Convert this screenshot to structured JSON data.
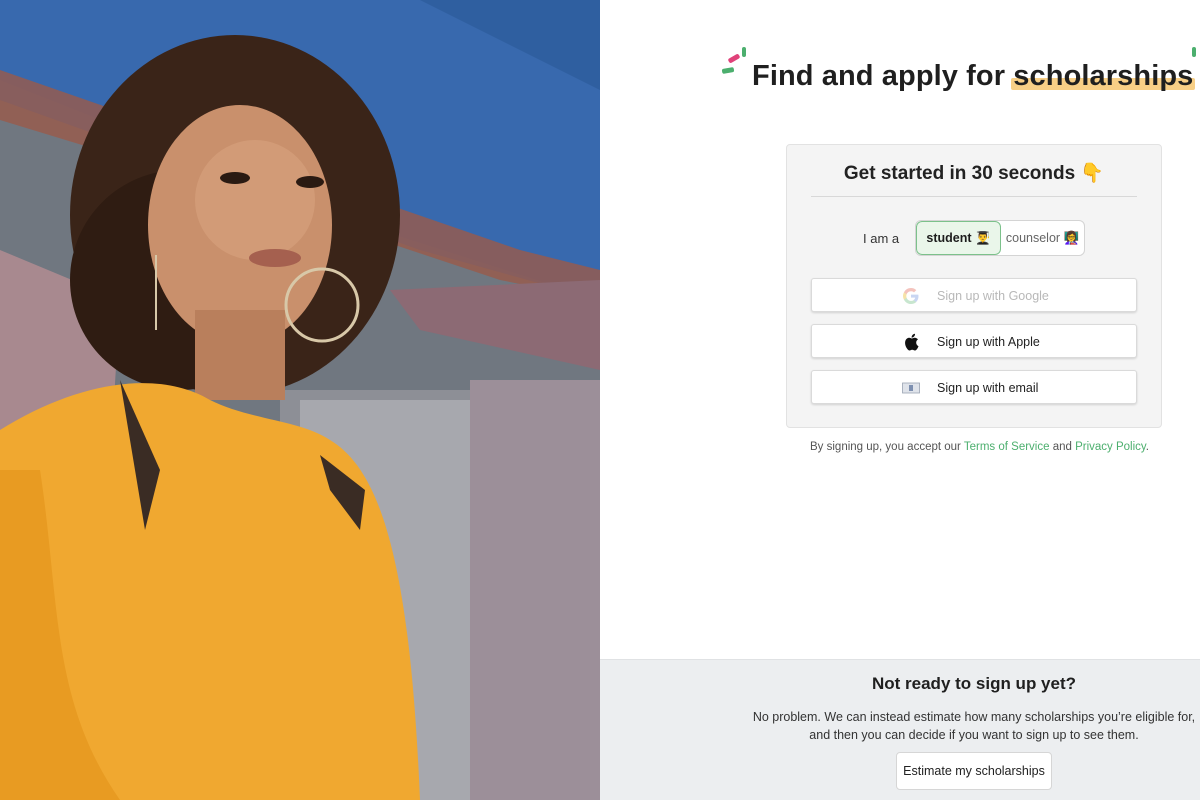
{
  "hero": {
    "headline_prefix": "Find and apply for ",
    "headline_highlight": "scholarships",
    "highlight_color": "#f8cf86"
  },
  "signup_card": {
    "title": "Get started in 30 seconds 👇",
    "role_label": "I am a",
    "roles": [
      {
        "label": "student 👨‍🎓",
        "selected": true
      },
      {
        "label": "counselor 👩‍🏫",
        "selected": false
      }
    ],
    "buttons": {
      "google": "Sign up with Google",
      "apple": "Sign up with Apple",
      "email": "Sign up with email"
    }
  },
  "legal": {
    "prefix": "By signing up, you accept our ",
    "terms": "Terms of Service",
    "and": " and ",
    "privacy": "Privacy Policy",
    "suffix": ".",
    "link_color": "#4caf6e"
  },
  "footer": {
    "title": "Not ready to sign up yet?",
    "text_line1": "No problem. We can instead estimate how many scholarships you’re eligible for,",
    "text_line2": "and then you can decide if you want to sign up to see them.",
    "button": "Estimate my scholarships"
  },
  "colors": {
    "accent_green": "#4caf6e",
    "selected_bg": "#eaf6ea",
    "footer_bg": "#eceef0"
  }
}
